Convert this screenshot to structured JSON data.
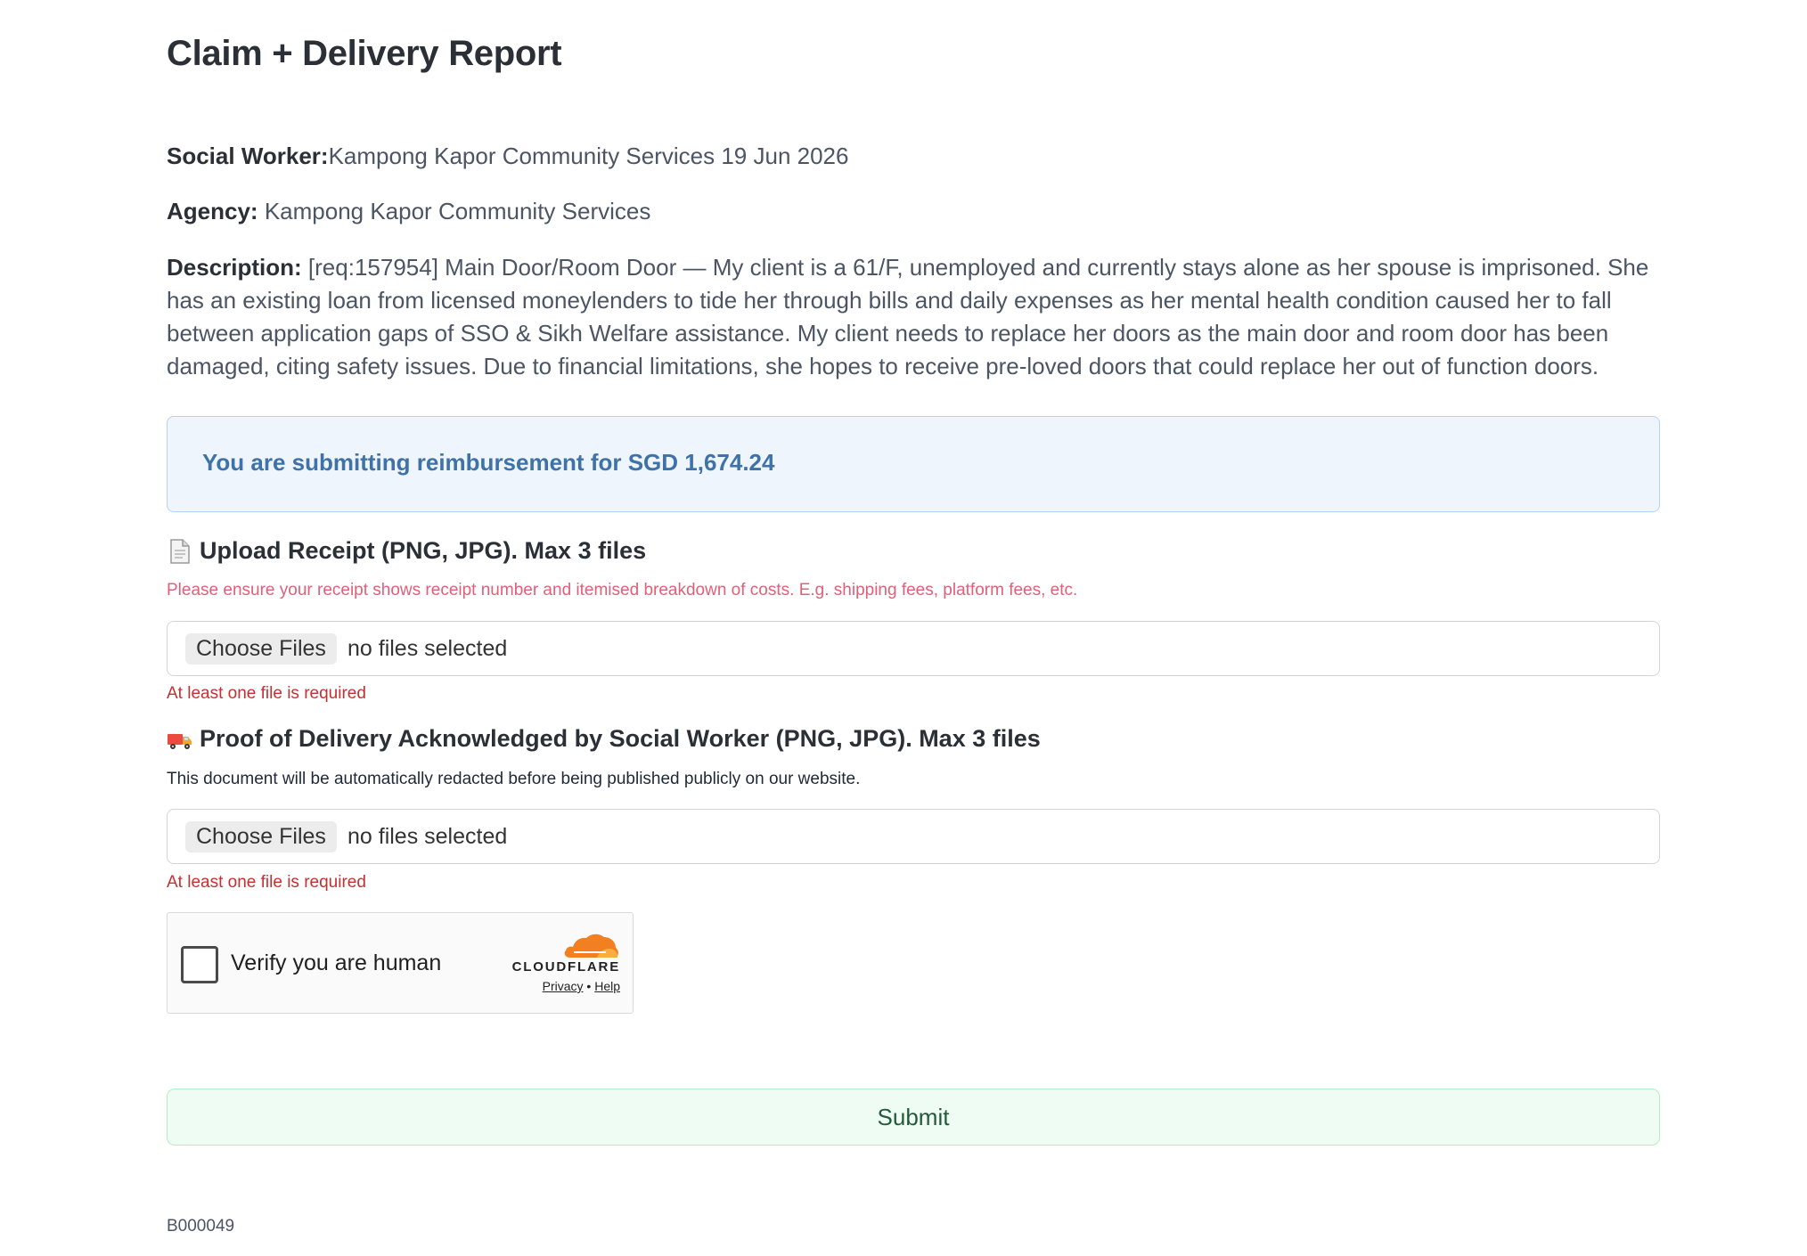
{
  "page": {
    "title": "Claim + Delivery Report"
  },
  "details": {
    "social_worker_label": "Social Worker:",
    "social_worker_value": "Kampong Kapor Community Services 19 Jun 2026",
    "agency_label": "Agency:",
    "agency_value": "Kampong Kapor Community Services",
    "description_label": "Description:",
    "description_value": "[req:157954] Main Door/Room Door — My client is a 61/F, unemployed and currently stays alone as her spouse is imprisoned. She has an existing loan from licensed moneylenders to tide her through bills and daily expenses as her mental health condition caused her to fall between application gaps of SSO & Sikh Welfare assistance.   My client needs to replace her doors as the main door and room door has been damaged, citing safety issues. Due to financial limitations, she hopes to receive pre-loved doors that could replace her out of function doors."
  },
  "banner": {
    "text": "You are submitting reimbursement for SGD 1,674.24"
  },
  "receipt": {
    "icon": "document-icon",
    "title": "Upload Receipt (PNG, JPG). Max 3 files",
    "hint": "Please ensure your receipt shows receipt number and itemised breakdown of costs. E.g. shipping fees, platform fees, etc.",
    "button_label": "Choose Files",
    "status": "no files selected",
    "error": "At least one file is required"
  },
  "delivery": {
    "icon": "delivery-truck-icon",
    "title": "Proof of Delivery Acknowledged by Social Worker (PNG, JPG). Max 3 files",
    "hint": "This document will be automatically redacted before being published publicly on our website.",
    "button_label": "Choose Files",
    "status": "no files selected",
    "error": "At least one file is required"
  },
  "captcha": {
    "label": "Verify you are human",
    "brand": "CLOUDFLARE",
    "privacy": "Privacy",
    "separator": "•",
    "help": "Help",
    "brand_color": "#f38020"
  },
  "form": {
    "submit_label": "Submit"
  },
  "footer": {
    "code": "B000049"
  }
}
